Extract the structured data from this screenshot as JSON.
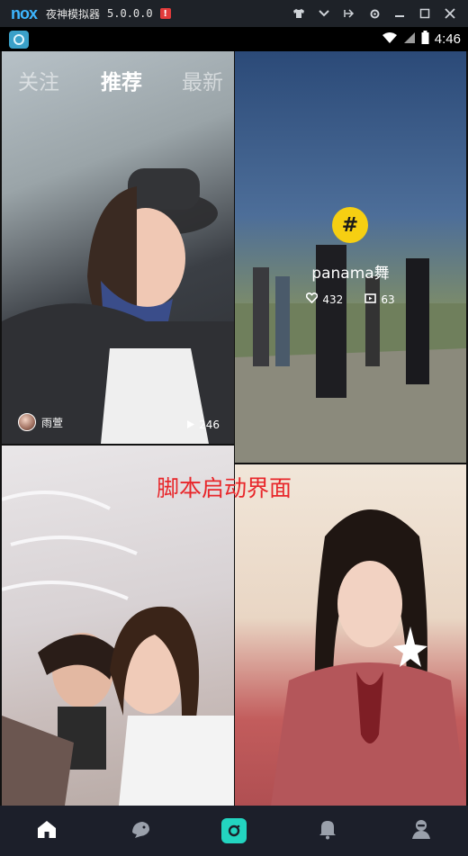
{
  "emulator": {
    "logo": "nox",
    "title": "夜神模拟器",
    "version": "5.0.0.0",
    "alert": "!",
    "controls": [
      "shirt-icon",
      "chevron-down-icon",
      "pin-icon",
      "gear-icon",
      "minimize-icon",
      "maximize-icon",
      "close-icon"
    ]
  },
  "status_bar": {
    "time": "4:46",
    "icons": [
      "wifi-icon",
      "signal-icon",
      "battery-icon"
    ]
  },
  "tabs": [
    {
      "label": "关注",
      "active": false
    },
    {
      "label": "推荐",
      "active": true
    },
    {
      "label": "最新",
      "active": false
    }
  ],
  "feed": {
    "tile_a": {
      "author": "雨萱",
      "plays": "246"
    },
    "tile_b": {
      "topic_icon": "#",
      "topic": "panama舞",
      "likes": "432",
      "videos": "63"
    }
  },
  "overlay_caption": "脚本启动界面",
  "bottom_nav": [
    {
      "icon": "home-icon",
      "active": true
    },
    {
      "icon": "bird-icon",
      "active": false
    },
    {
      "icon": "camera-icon",
      "active": false
    },
    {
      "icon": "bell-icon",
      "active": false
    },
    {
      "icon": "profile-icon",
      "active": false
    }
  ],
  "colors": {
    "accent_camera": "#23d4c0",
    "topic_badge": "#f6cf12",
    "caption_red": "#e8262a",
    "nav_bg": "#1c1f2a"
  }
}
